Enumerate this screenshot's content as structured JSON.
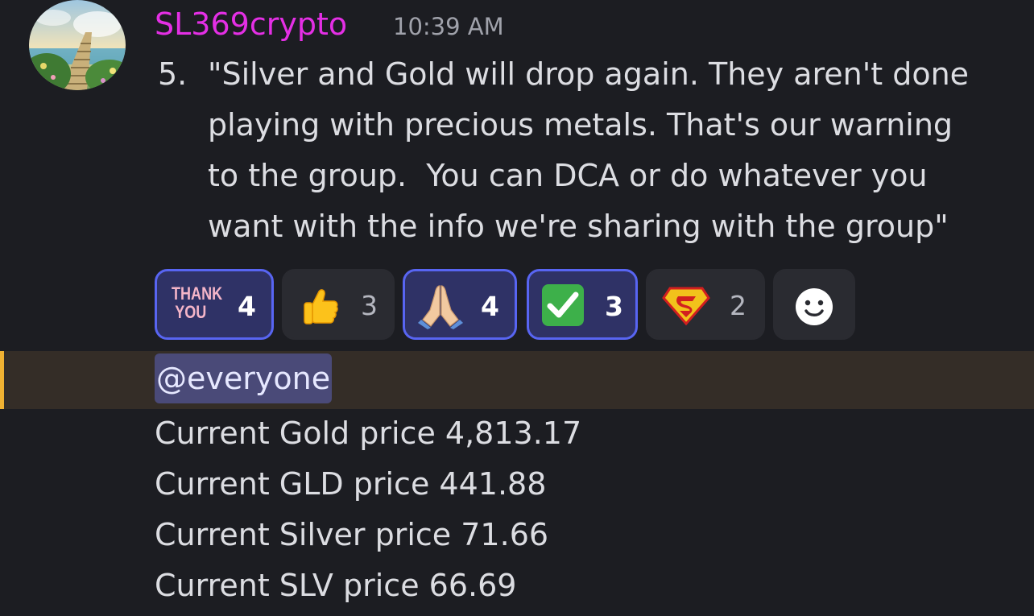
{
  "message": {
    "username": "SL369crypto",
    "timestamp": "10:39 AM",
    "list_number": "5.",
    "quote_lines": [
      "\"Silver and Gold will drop again. They aren't done",
      "playing with precious metals. That's our warning",
      "to the group.  You can DCA or do whatever you",
      "want with the info we're sharing with the group\""
    ],
    "username_color": "#e42fe5"
  },
  "reactions": [
    {
      "emoji": "thank-you-sticker",
      "label": "THANK YOU",
      "label_top": "THANK",
      "label_bottom": "YOU",
      "count": "4",
      "me": true
    },
    {
      "emoji": "thumbs-up",
      "count": "3",
      "me": false
    },
    {
      "emoji": "folded-hands",
      "count": "4",
      "me": true
    },
    {
      "emoji": "check-mark-button",
      "count": "3",
      "me": true
    },
    {
      "emoji": "superman-shield",
      "count": "2",
      "me": false
    },
    {
      "emoji": "add-reaction-smiley",
      "count": "",
      "me": false
    }
  ],
  "mention": {
    "text": "@everyone",
    "highlight_color": "#f0b232"
  },
  "prices": [
    "Current Gold price 4,813.17",
    "Current GLD price 441.88",
    "Current Silver price 71.66",
    "Current SLV price 66.69"
  ],
  "colors": {
    "background": "#1c1d22",
    "accent": "#5865f2",
    "mention_row_bg": "#342d27"
  }
}
